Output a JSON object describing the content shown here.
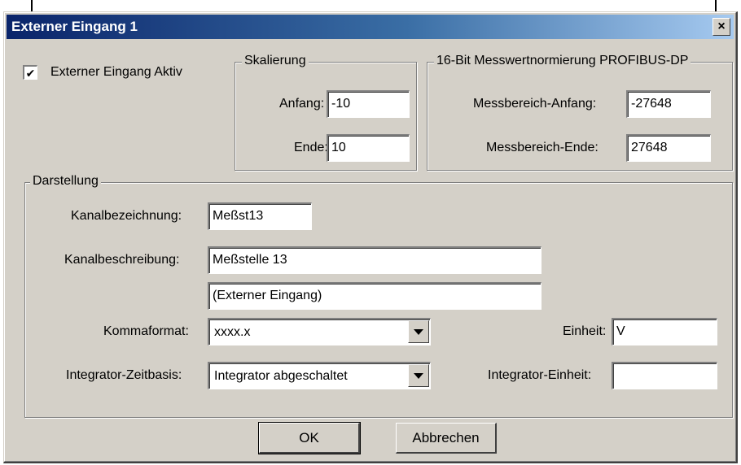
{
  "window": {
    "title": "Externer Eingang 1",
    "close_glyph": "×",
    "close_icon": "close-icon"
  },
  "active_checkbox": {
    "label": "Externer Eingang Aktiv",
    "checked": true,
    "check_glyph": "✔"
  },
  "skalierung": {
    "legend": "Skalierung",
    "anfang_label": "Anfang:",
    "anfang_value": "-10",
    "ende_label": "Ende:",
    "ende_value": "10"
  },
  "normierung": {
    "legend": "16-Bit Messwertnormierung PROFIBUS-DP",
    "anfang_label": "Messbereich-Anfang:",
    "anfang_value": "-27648",
    "ende_label": "Messbereich-Ende:",
    "ende_value": "27648"
  },
  "darstellung": {
    "legend": "Darstellung",
    "kanalbezeichnung_label": "Kanalbezeichnung:",
    "kanalbezeichnung_value": "Meßst13",
    "kanalbeschreibung_label": "Kanalbeschreibung:",
    "kanalbeschreibung_line1": "Meßstelle 13",
    "kanalbeschreibung_line2": "(Externer Eingang)",
    "kommaformat_label": "Kommaformat:",
    "kommaformat_value": "xxxx.x",
    "einheit_label": "Einheit:",
    "einheit_value": "V",
    "zeitbasis_label": "Integrator-Zeitbasis:",
    "zeitbasis_value": "Integrator abgeschaltet",
    "integrator_einheit_label": "Integrator-Einheit:",
    "integrator_einheit_value": ""
  },
  "buttons": {
    "ok": "OK",
    "cancel": "Abbrechen"
  },
  "colors": {
    "title_start": "#0a246a",
    "title_end": "#a6caf0",
    "face": "#d4d0c8"
  }
}
